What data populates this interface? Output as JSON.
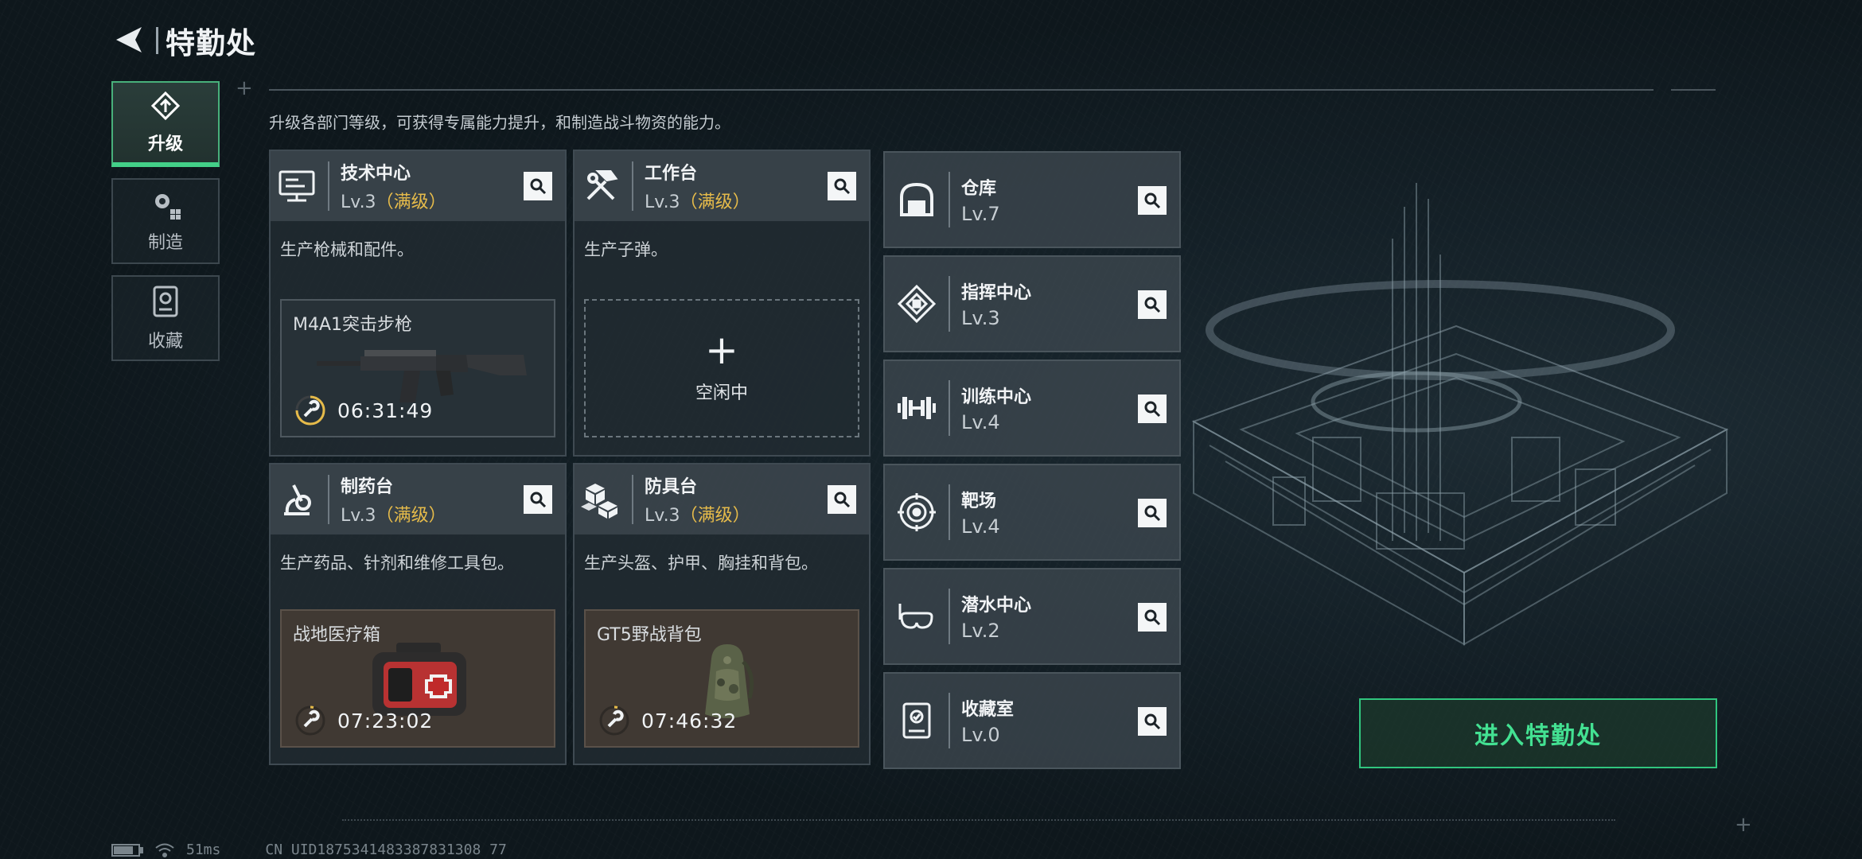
{
  "header": {
    "title": "特勤处",
    "back_icon": "back-arrow-icon"
  },
  "sidenav": {
    "items": [
      {
        "label": "升级",
        "icon": "upgrade-icon",
        "active": true
      },
      {
        "label": "制造",
        "icon": "gear-icon",
        "active": false
      },
      {
        "label": "收藏",
        "icon": "collection-icon",
        "active": false
      }
    ]
  },
  "description": "升级各部门等级，可获得专属能力提升，和制造战斗物资的能力。",
  "cards": [
    {
      "name": "技术中心",
      "level": "Lv.3",
      "max": "（满级）",
      "desc": "生产枪械和配件。",
      "icon": "computer-icon",
      "product": {
        "name": "M4A1突击步枪",
        "timer": "06:31:49"
      }
    },
    {
      "name": "工作台",
      "level": "Lv.3",
      "max": "（满级）",
      "desc": "生产子弹。",
      "icon": "tools-icon",
      "idle_label": "空闲中"
    },
    {
      "name": "制药台",
      "level": "Lv.3",
      "max": "（满级）",
      "desc": "生产药品、针剂和维修工具包。",
      "icon": "microscope-icon",
      "product": {
        "name": "战地医疗箱",
        "timer": "07:23:02"
      }
    },
    {
      "name": "防具台",
      "level": "Lv.3",
      "max": "（满级）",
      "desc": "生产头盔、护甲、胸挂和背包。",
      "icon": "cubes-icon",
      "product": {
        "name": "GT5野战背包",
        "timer": "07:46:32"
      }
    }
  ],
  "right_cards": [
    {
      "name": "仓库",
      "level": "Lv.7",
      "icon": "warehouse-icon"
    },
    {
      "name": "指挥中心",
      "level": "Lv.3",
      "icon": "command-icon"
    },
    {
      "name": "训练中心",
      "level": "Lv.4",
      "icon": "dumbbell-icon"
    },
    {
      "name": "靶场",
      "level": "Lv.4",
      "icon": "target-icon"
    },
    {
      "name": "潜水中心",
      "level": "Lv.2",
      "icon": "diving-mask-icon"
    },
    {
      "name": "收藏室",
      "level": "Lv.0",
      "icon": "collection-room-icon"
    }
  ],
  "enter_button": "进入特勤处",
  "status": {
    "ping": "51ms",
    "uid": "CN UID1875341483387831308 77"
  },
  "colors": {
    "accent": "#43e192",
    "max_level": "#e6bb4a",
    "active_tab": "#43d088"
  }
}
